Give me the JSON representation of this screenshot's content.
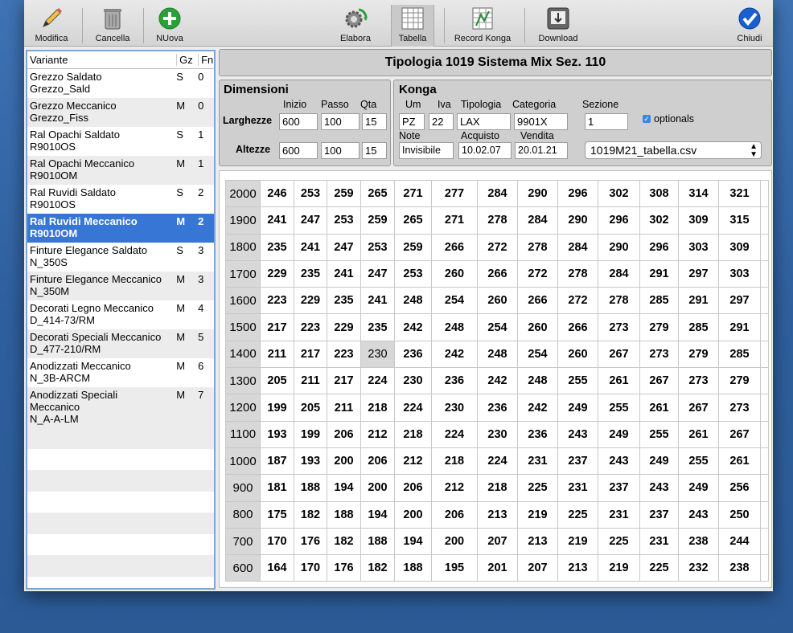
{
  "toolbar": {
    "modifica": "Modifica",
    "cancella": "Cancella",
    "nuova": "NUova",
    "elabora": "Elabora",
    "tabella": "Tabella",
    "record_konga": "Record Konga",
    "download": "Download",
    "chiudi": "Chiudi"
  },
  "sidebar": {
    "headers": {
      "variante": "Variante",
      "gz": "Gz",
      "fn": "Fn"
    },
    "items": [
      {
        "l1": "Grezzo Saldato",
        "l2": "Grezzo_Sald",
        "gz": "S",
        "fn": "0"
      },
      {
        "l1": "Grezzo Meccanico",
        "l2": "Grezzo_Fiss",
        "gz": "M",
        "fn": "0"
      },
      {
        "l1": "Ral Opachi Saldato",
        "l2": "R9010OS",
        "gz": "S",
        "fn": "1"
      },
      {
        "l1": "Ral Opachi Meccanico",
        "l2": "R9010OM",
        "gz": "M",
        "fn": "1"
      },
      {
        "l1": "Ral Ruvidi Saldato",
        "l2": "R9010OS",
        "gz": "S",
        "fn": "2"
      },
      {
        "l1": "Ral Ruvidi Meccanico",
        "l2": "R9010OM",
        "gz": "M",
        "fn": "2"
      },
      {
        "l1": "Finture Elegance Saldato",
        "l2": "N_350S",
        "gz": "S",
        "fn": "3"
      },
      {
        "l1": "Finture Elegance Meccanico",
        "l2": "N_350M",
        "gz": "M",
        "fn": "3"
      },
      {
        "l1": "Decorati Legno Meccanico",
        "l2": "D_414-73/RM",
        "gz": "M",
        "fn": "4"
      },
      {
        "l1": "Decorati Speciali Meccanico",
        "l2": "D_477-210/RM",
        "gz": "M",
        "fn": "5"
      },
      {
        "l1": "Anodizzati Meccanico",
        "l2": "N_3B-ARCM",
        "gz": "M",
        "fn": "6"
      },
      {
        "l1": "Anodizzati Speciali",
        "l2": "Meccanico",
        "l3": "N_A-A-LM",
        "gz": "M",
        "fn": "7"
      }
    ]
  },
  "title": "Tipologia 1019 Sistema Mix Sez. 110",
  "dimensioni": {
    "title": "Dimensioni",
    "inizio_label": "Inizio",
    "passo_label": "Passo",
    "qta_label": "Qta",
    "larghezze_label": "Larghezze",
    "altezze_label": "Altezze",
    "larg": {
      "inizio": "600",
      "passo": "100",
      "qta": "15"
    },
    "alt": {
      "inizio": "600",
      "passo": "100",
      "qta": "15"
    }
  },
  "konga": {
    "title": "Konga",
    "um_label": "Um",
    "iva_label": "Iva",
    "tipologia_label": "Tipologia",
    "categoria_label": "Categoria",
    "sezione_label": "Sezione",
    "note_label": "Note",
    "acquisto_label": "Acquisto",
    "vendita_label": "Vendita",
    "um": "PZ",
    "iva": "22",
    "tipologia": "LAX",
    "categoria": "9901X",
    "sezione": "1",
    "optionals": "optionals",
    "note": "Invisibile",
    "acquisto": "10.02.07",
    "vendita": "20.01.21",
    "file": "1019M21_tabella.csv"
  },
  "table": {
    "rows": [
      {
        "h": "2000",
        "v": [
          "246",
          "253",
          "259",
          "265",
          "271",
          "277",
          "284",
          "290",
          "296",
          "302",
          "308",
          "314",
          "321"
        ]
      },
      {
        "h": "1900",
        "v": [
          "241",
          "247",
          "253",
          "259",
          "265",
          "271",
          "278",
          "284",
          "290",
          "296",
          "302",
          "309",
          "315"
        ]
      },
      {
        "h": "1800",
        "v": [
          "235",
          "241",
          "247",
          "253",
          "259",
          "266",
          "272",
          "278",
          "284",
          "290",
          "296",
          "303",
          "309"
        ]
      },
      {
        "h": "1700",
        "v": [
          "229",
          "235",
          "241",
          "247",
          "253",
          "260",
          "266",
          "272",
          "278",
          "284",
          "291",
          "297",
          "303"
        ]
      },
      {
        "h": "1600",
        "v": [
          "223",
          "229",
          "235",
          "241",
          "248",
          "254",
          "260",
          "266",
          "272",
          "278",
          "285",
          "291",
          "297"
        ]
      },
      {
        "h": "1500",
        "v": [
          "217",
          "223",
          "229",
          "235",
          "242",
          "248",
          "254",
          "260",
          "266",
          "273",
          "279",
          "285",
          "291"
        ]
      },
      {
        "h": "1400",
        "v": [
          "211",
          "217",
          "223",
          "230",
          "236",
          "242",
          "248",
          "254",
          "260",
          "267",
          "273",
          "279",
          "285"
        ]
      },
      {
        "h": "1300",
        "v": [
          "205",
          "211",
          "217",
          "224",
          "230",
          "236",
          "242",
          "248",
          "255",
          "261",
          "267",
          "273",
          "279"
        ]
      },
      {
        "h": "1200",
        "v": [
          "199",
          "205",
          "211",
          "218",
          "224",
          "230",
          "236",
          "242",
          "249",
          "255",
          "261",
          "267",
          "273"
        ]
      },
      {
        "h": "1100",
        "v": [
          "193",
          "199",
          "206",
          "212",
          "218",
          "224",
          "230",
          "236",
          "243",
          "249",
          "255",
          "261",
          "267"
        ]
      },
      {
        "h": "1000",
        "v": [
          "187",
          "193",
          "200",
          "206",
          "212",
          "218",
          "224",
          "231",
          "237",
          "243",
          "249",
          "255",
          "261"
        ]
      },
      {
        "h": "900",
        "v": [
          "181",
          "188",
          "194",
          "200",
          "206",
          "212",
          "218",
          "225",
          "231",
          "237",
          "243",
          "249",
          "256"
        ]
      },
      {
        "h": "800",
        "v": [
          "175",
          "182",
          "188",
          "194",
          "200",
          "206",
          "213",
          "219",
          "225",
          "231",
          "237",
          "243",
          "250"
        ]
      },
      {
        "h": "700",
        "v": [
          "170",
          "176",
          "182",
          "188",
          "194",
          "200",
          "207",
          "213",
          "219",
          "225",
          "231",
          "238",
          "244"
        ]
      },
      {
        "h": "600",
        "v": [
          "164",
          "170",
          "176",
          "182",
          "188",
          "195",
          "201",
          "207",
          "213",
          "219",
          "225",
          "232",
          "238"
        ]
      }
    ]
  }
}
